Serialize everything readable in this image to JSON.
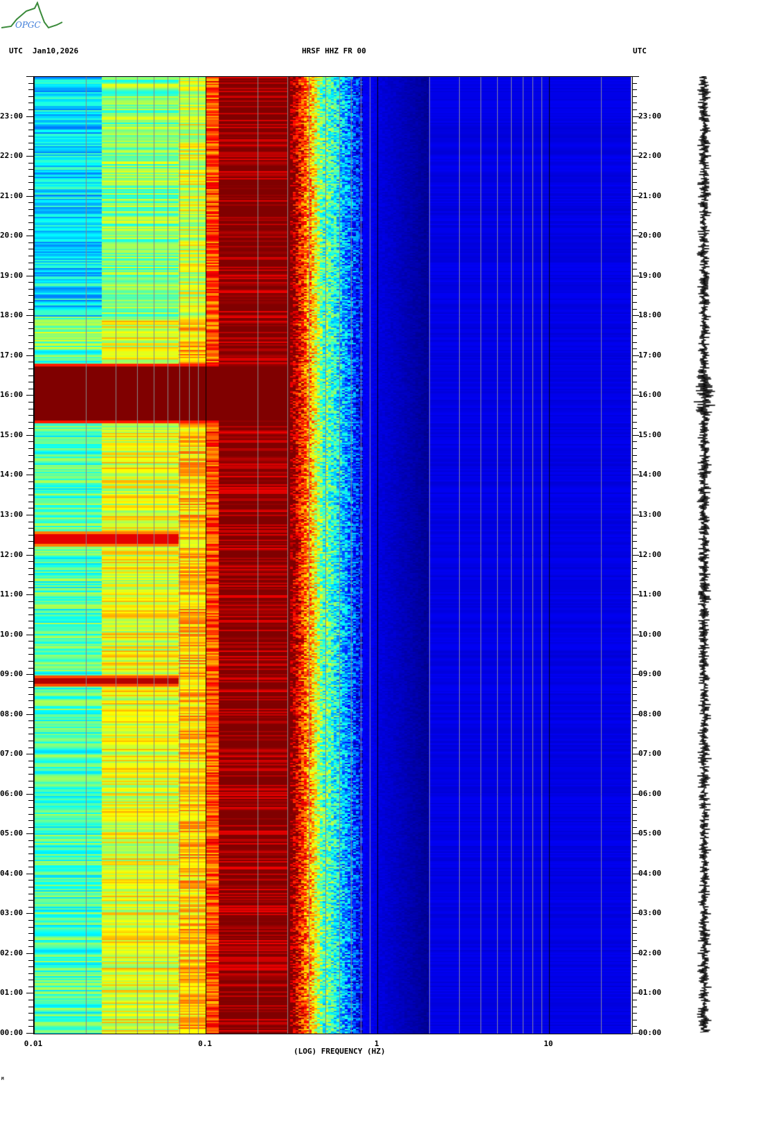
{
  "header": {
    "left_tz": "UTC",
    "date": "Jan10,2026",
    "station": "HRSF HHZ FR 00",
    "right_tz": "UTC",
    "logo_text": "OPGC"
  },
  "footer_mark": "M",
  "chart_data": {
    "type": "heatmap",
    "title": "HRSF HHZ FR 00",
    "xlabel": "(LOG) FREQUENCY (HZ)",
    "ylabel": "UTC",
    "x_scale": "log",
    "xlim": [
      0.01,
      30
    ],
    "ylim_hours": [
      0,
      24
    ],
    "x_ticks": [
      {
        "value": 0.01,
        "label": "0.01"
      },
      {
        "value": 0.1,
        "label": "0.1"
      },
      {
        "value": 1,
        "label": "1"
      },
      {
        "value": 10,
        "label": "10"
      }
    ],
    "y_ticks": [
      "00:00",
      "01:00",
      "02:00",
      "03:00",
      "04:00",
      "05:00",
      "06:00",
      "07:00",
      "08:00",
      "09:00",
      "10:00",
      "11:00",
      "12:00",
      "13:00",
      "14:00",
      "15:00",
      "16:00",
      "17:00",
      "18:00",
      "19:00",
      "20:00",
      "21:00",
      "22:00",
      "23:00"
    ],
    "colormap": "jet",
    "grid": true,
    "frequency_bands": [
      {
        "fmin": 0.01,
        "fmax": 0.025,
        "level": 0.45
      },
      {
        "fmin": 0.025,
        "fmax": 0.07,
        "level": 0.6
      },
      {
        "fmin": 0.07,
        "fmax": 0.1,
        "level": 0.68
      },
      {
        "fmin": 0.1,
        "fmax": 0.12,
        "level": 0.8
      },
      {
        "fmin": 0.12,
        "fmax": 0.3,
        "level": 1.0
      },
      {
        "fmin": 0.3,
        "fmax": 0.4,
        "level": 0.88
      },
      {
        "fmin": 0.4,
        "fmax": 0.5,
        "level": 0.55
      },
      {
        "fmin": 0.5,
        "fmax": 0.8,
        "level": 0.3
      },
      {
        "fmin": 0.8,
        "fmax": 2,
        "level": 0.08
      },
      {
        "fmin": 2,
        "fmax": 30,
        "level": 0.1
      }
    ],
    "events": [
      {
        "start_hour": 15.3,
        "end_hour": 16.8,
        "fmax": 0.12,
        "level": 1.0
      },
      {
        "start_hour": 8.7,
        "end_hour": 9.0,
        "fmax": 0.07,
        "level": 0.95
      },
      {
        "start_hour": 12.2,
        "end_hour": 12.6,
        "fmax": 0.07,
        "level": 0.9
      }
    ]
  }
}
